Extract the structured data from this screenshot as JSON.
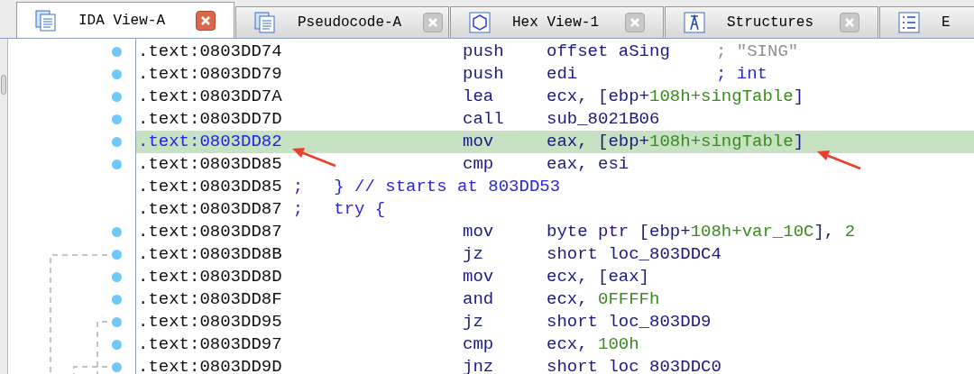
{
  "tabs": [
    {
      "label": "IDA View-A",
      "kind": "document",
      "selected": true
    },
    {
      "label": "Pseudocode-A",
      "kind": "document",
      "selected": false
    },
    {
      "label": "Hex View-1",
      "kind": "hexagon",
      "selected": false
    },
    {
      "label": "Structures",
      "kind": "structure",
      "selected": false
    },
    {
      "label": "E",
      "kind": "list",
      "selected": false
    }
  ],
  "listing": [
    {
      "kind": "instruction",
      "address": ".text:0803DD74",
      "selected": false,
      "mnemonic": "push",
      "operands": [
        {
          "text": "offset aSing",
          "kind": "name"
        }
      ],
      "comment": {
        "text": "; \"SING\"",
        "kind": "string"
      }
    },
    {
      "kind": "instruction",
      "address": ".text:0803DD79",
      "selected": false,
      "mnemonic": "push",
      "operands": [
        {
          "text": "edi",
          "kind": "name"
        }
      ],
      "comment": {
        "text": "; int",
        "kind": "type"
      }
    },
    {
      "kind": "instruction",
      "address": ".text:0803DD7A",
      "selected": false,
      "mnemonic": "lea",
      "operands": [
        {
          "text": "ecx, [ebp+",
          "kind": "name"
        },
        {
          "text": "108h+singTable",
          "kind": "number"
        },
        {
          "text": "]",
          "kind": "name"
        }
      ]
    },
    {
      "kind": "instruction",
      "address": ".text:0803DD7D",
      "selected": false,
      "mnemonic": "call",
      "operands": [
        {
          "text": "sub_8021B06",
          "kind": "name"
        }
      ]
    },
    {
      "kind": "instruction",
      "address": ".text:0803DD82",
      "selected": true,
      "mnemonic": "mov",
      "operands": [
        {
          "text": "eax, [ebp+",
          "kind": "name"
        },
        {
          "text": "108h+singTable",
          "kind": "number"
        },
        {
          "text": "]",
          "kind": "name"
        }
      ]
    },
    {
      "kind": "instruction",
      "address": ".text:0803DD85",
      "selected": false,
      "mnemonic": "cmp",
      "operands": [
        {
          "text": "eax, esi",
          "kind": "name"
        }
      ]
    },
    {
      "kind": "comment",
      "address": ".text:0803DD85",
      "selected": false,
      "text": ";   } // starts at 803DD53"
    },
    {
      "kind": "comment",
      "address": ".text:0803DD87",
      "selected": false,
      "text": ";   try {"
    },
    {
      "kind": "instruction",
      "address": ".text:0803DD87",
      "selected": false,
      "mnemonic": "mov",
      "operands": [
        {
          "text": "byte ptr [ebp+",
          "kind": "name"
        },
        {
          "text": "108h+var_10C",
          "kind": "number"
        },
        {
          "text": "], ",
          "kind": "name"
        },
        {
          "text": "2",
          "kind": "number"
        }
      ]
    },
    {
      "kind": "instruction",
      "address": ".text:0803DD8B",
      "selected": false,
      "mnemonic": "jz",
      "operands": [
        {
          "text": "short loc_803DDC4",
          "kind": "name"
        }
      ]
    },
    {
      "kind": "instruction",
      "address": ".text:0803DD8D",
      "selected": false,
      "mnemonic": "mov",
      "operands": [
        {
          "text": "ecx, [eax]",
          "kind": "name"
        }
      ]
    },
    {
      "kind": "instruction",
      "address": ".text:0803DD8F",
      "selected": false,
      "mnemonic": "and",
      "operands": [
        {
          "text": "ecx, ",
          "kind": "name"
        },
        {
          "text": "0FFFFh",
          "kind": "number"
        }
      ]
    },
    {
      "kind": "instruction",
      "address": ".text:0803DD95",
      "selected": false,
      "mnemonic": "jz",
      "operands": [
        {
          "text": "short loc_803DD9",
          "kind": "name"
        }
      ]
    },
    {
      "kind": "instruction",
      "address": ".text:0803DD97",
      "selected": false,
      "mnemonic": "cmp",
      "operands": [
        {
          "text": "ecx, ",
          "kind": "name"
        },
        {
          "text": "100h",
          "kind": "number"
        }
      ]
    },
    {
      "kind": "instruction",
      "address": ".text:0803DD9D",
      "selected": false,
      "mnemonic": "jnz",
      "operands": [
        {
          "text": "short loc 803DDC0",
          "kind": "name"
        }
      ]
    }
  ]
}
